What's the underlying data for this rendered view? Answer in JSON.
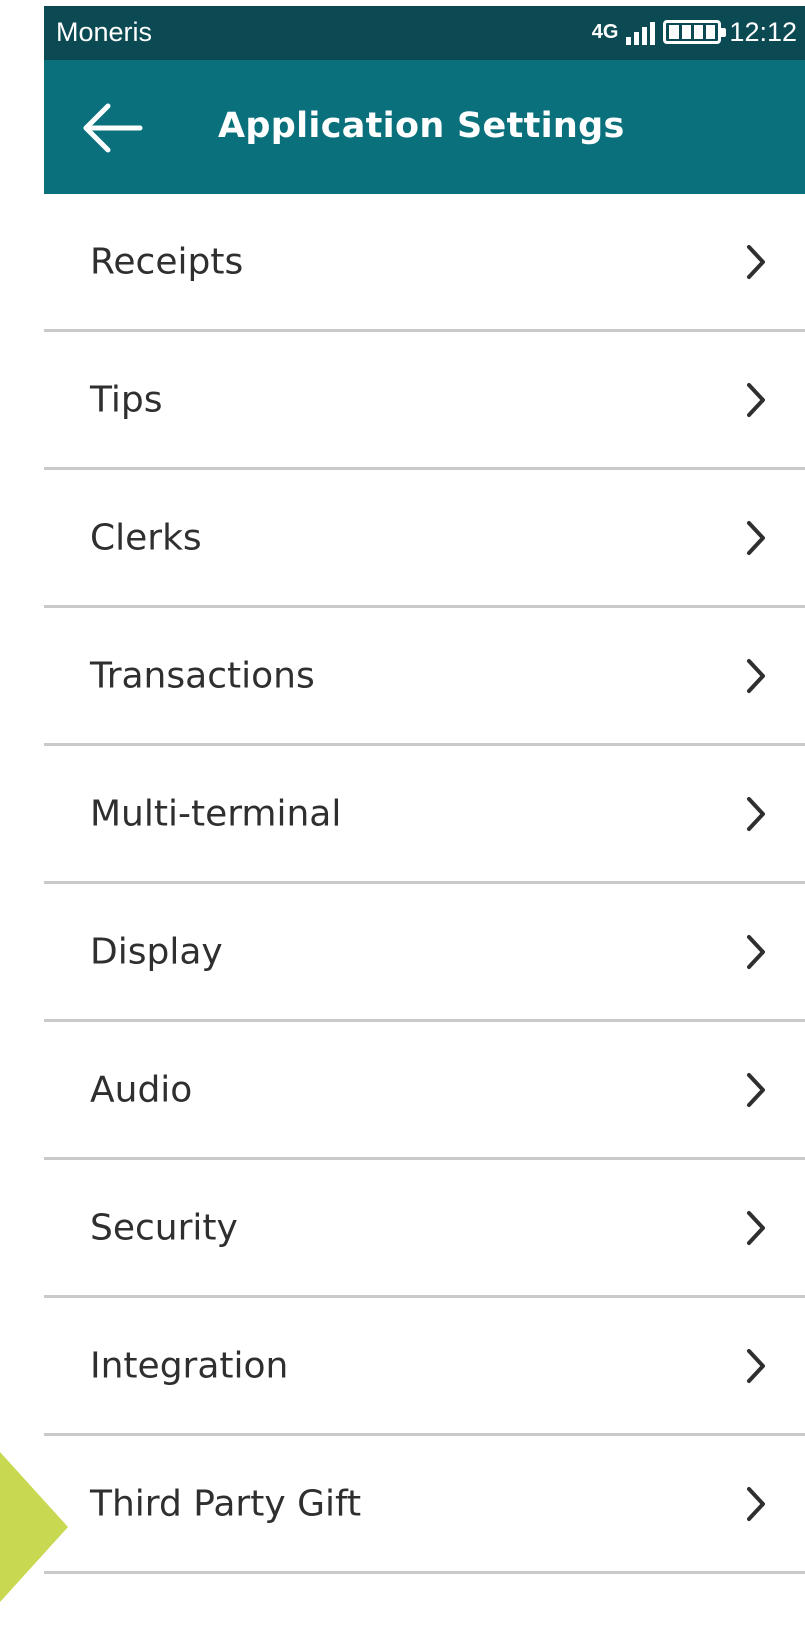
{
  "status_bar": {
    "carrier": "Moneris",
    "network": "4G",
    "time": "12:12",
    "signal_icon": "signal-bars-icon",
    "battery_icon": "battery-icon"
  },
  "app_bar": {
    "title": "Application Settings",
    "back_icon": "arrow-left-icon"
  },
  "settings": {
    "items": [
      {
        "label": "Receipts"
      },
      {
        "label": "Tips"
      },
      {
        "label": "Clerks"
      },
      {
        "label": "Transactions"
      },
      {
        "label": "Multi-terminal"
      },
      {
        "label": "Display"
      },
      {
        "label": "Audio"
      },
      {
        "label": "Security"
      },
      {
        "label": "Integration"
      },
      {
        "label": "Third Party Gift"
      }
    ],
    "chevron_icon": "chevron-right-icon"
  },
  "colors": {
    "status_bar": "#0c4a53",
    "app_bar": "#09707c",
    "divider": "#c9c9c9",
    "pointer": "#c8d850",
    "text": "#2f2f2f"
  }
}
